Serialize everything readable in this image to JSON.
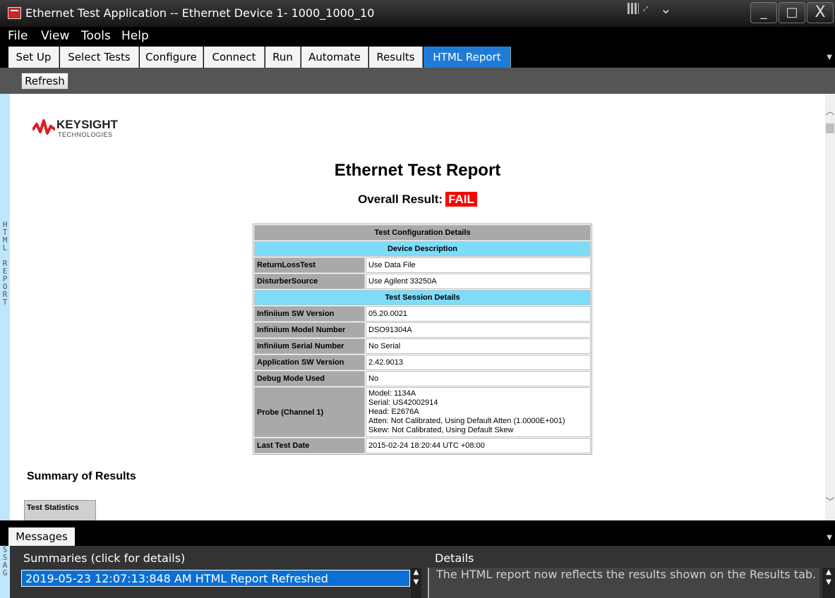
{
  "window": {
    "title": "Ethernet Test Application -- Ethernet Device 1- 1000_1000_10",
    "minimize_glyph": "_",
    "maximize_glyph": "□",
    "close_glyph": "X"
  },
  "menu": [
    "File",
    "View",
    "Tools",
    "Help"
  ],
  "tabs": [
    {
      "label": "Set Up",
      "active": false
    },
    {
      "label": "Select Tests",
      "active": false
    },
    {
      "label": "Configure",
      "active": false
    },
    {
      "label": "Connect",
      "active": false
    },
    {
      "label": "Run",
      "active": false
    },
    {
      "label": "Automate",
      "active": false
    },
    {
      "label": "Results",
      "active": false
    },
    {
      "label": "HTML Report",
      "active": true
    }
  ],
  "toolbar": {
    "refresh_label": "Refresh"
  },
  "side_label": "HTML REPORT",
  "report": {
    "logo_name": "KEYSIGHT",
    "logo_sub": "TECHNOLOGIES",
    "title": "Ethernet Test Report",
    "overall_label": "Overall Result:",
    "overall_value": "FAIL",
    "config": {
      "heading": "Test Configuration Details",
      "device_section": "Device Description",
      "device_rows": [
        {
          "label": "ReturnLossTest",
          "value": "Use Data File"
        },
        {
          "label": "DisturberSource",
          "value": "Use Agilent 33250A"
        }
      ],
      "session_section": "Test Session Details",
      "session_rows": [
        {
          "label": "Infiniium SW Version",
          "value": "05.20.0021"
        },
        {
          "label": "Infiniium Model Number",
          "value": "DSO91304A"
        },
        {
          "label": "Infiniium Serial Number",
          "value": "No Serial"
        },
        {
          "label": "Application SW Version",
          "value": "2.42.9013"
        },
        {
          "label": "Debug Mode Used",
          "value": "No"
        }
      ],
      "probe_label": "Probe (Channel 1)",
      "probe_lines": [
        "Model: 1134A",
        "Serial: US42002914",
        "Head: E2676A",
        "Atten: Not Calibrated, Using Default Atten (1.0000E+001)",
        "Skew: Not Calibrated, Using Default Skew"
      ],
      "last_date_label": "Last Test Date",
      "last_date_value": "2015-02-24 18:20:44 UTC +08:00"
    },
    "summary_title": "Summary of Results",
    "stats_label": "Test Statistics"
  },
  "messages": {
    "tab_label": "Messages",
    "side_label": "SSAG",
    "summaries_header": "Summaries (click for details)",
    "details_header": "Details",
    "summary_item": "2019-05-23 12:07:13:848 AM HTML Report Refreshed",
    "details_text": "The HTML report now reflects the results shown on the Results tab."
  },
  "colors": {
    "accent": "#1e7cd6",
    "fail": "#ff0000",
    "section": "#7fdcf8",
    "label_bg": "#a9a9a9",
    "brand_red": "#e01b22"
  }
}
